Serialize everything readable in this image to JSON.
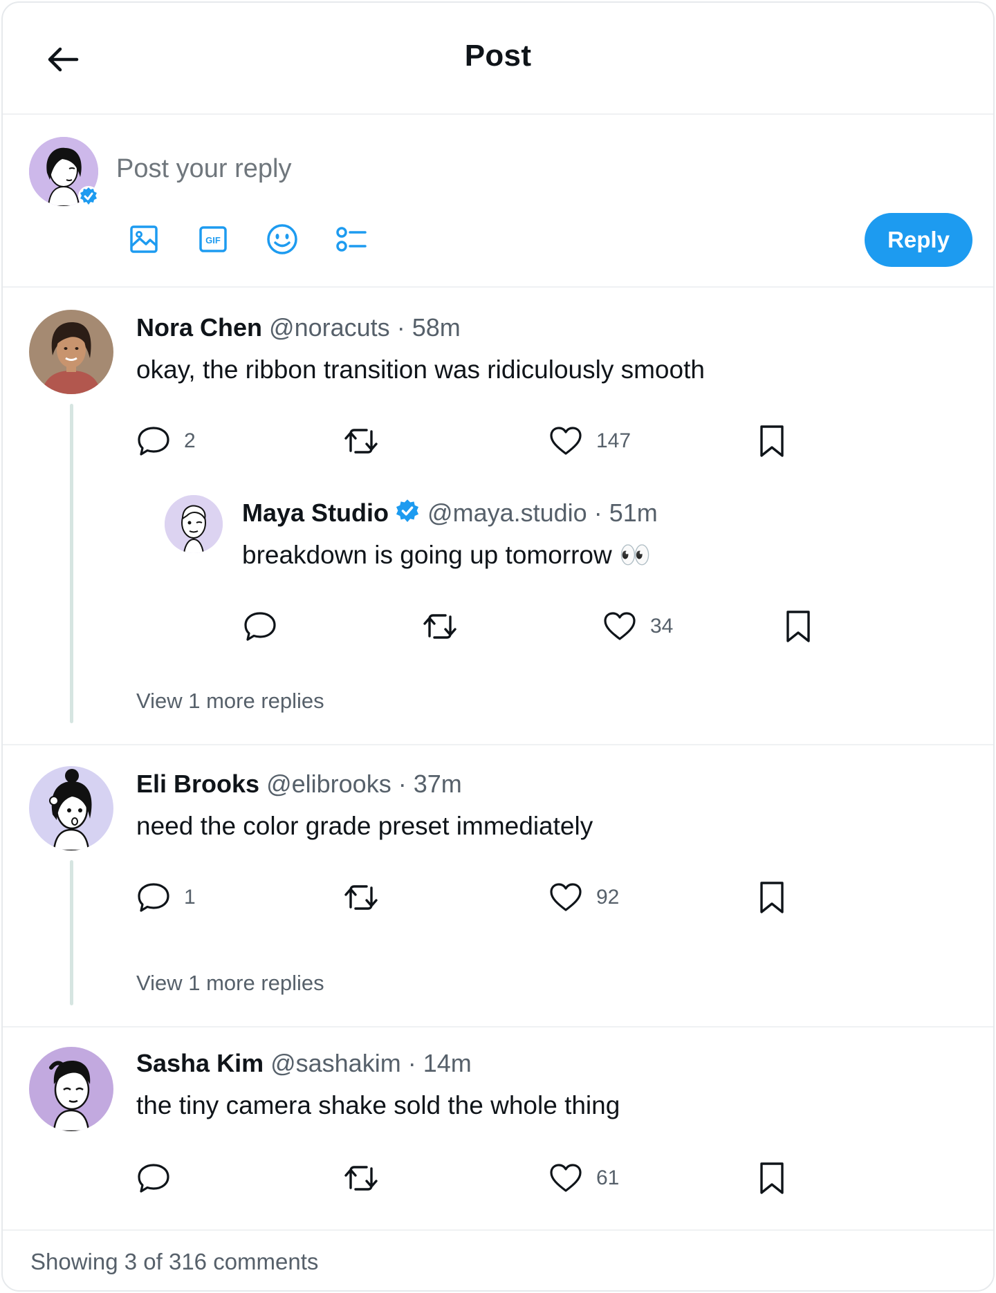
{
  "header": {
    "title": "Post"
  },
  "composer": {
    "placeholder": "Post your reply",
    "reply_label": "Reply",
    "tools": [
      "image-icon",
      "gif-icon",
      "emoji-icon",
      "poll-icon"
    ]
  },
  "comments": [
    {
      "name": "Nora Chen",
      "handle": "@noracuts",
      "time": "58m",
      "text": "okay, the ribbon transition was ridiculously smooth",
      "replies": "2",
      "likes": "147",
      "nested": {
        "name": "Maya Studio",
        "verified": true,
        "handle": "@maya.studio",
        "time": "51m",
        "text": "breakdown is going up tomorrow 👀",
        "likes": "34"
      },
      "view_more": "View 1 more replies"
    },
    {
      "name": "Eli Brooks",
      "handle": "@elibrooks",
      "time": "37m",
      "text": "need the color grade preset immediately",
      "replies": "1",
      "likes": "92",
      "view_more": "View 1 more replies"
    },
    {
      "name": "Sasha Kim",
      "handle": "@sashakim",
      "time": "14m",
      "text": "the tiny camera shake sold the whole thing",
      "likes": "61"
    }
  ],
  "footer": {
    "status": "Showing 3 of 316 comments"
  },
  "colors": {
    "accent": "#1d9bf0",
    "thread_line": "#d6e5e1",
    "verified": "#1d9bf0"
  }
}
